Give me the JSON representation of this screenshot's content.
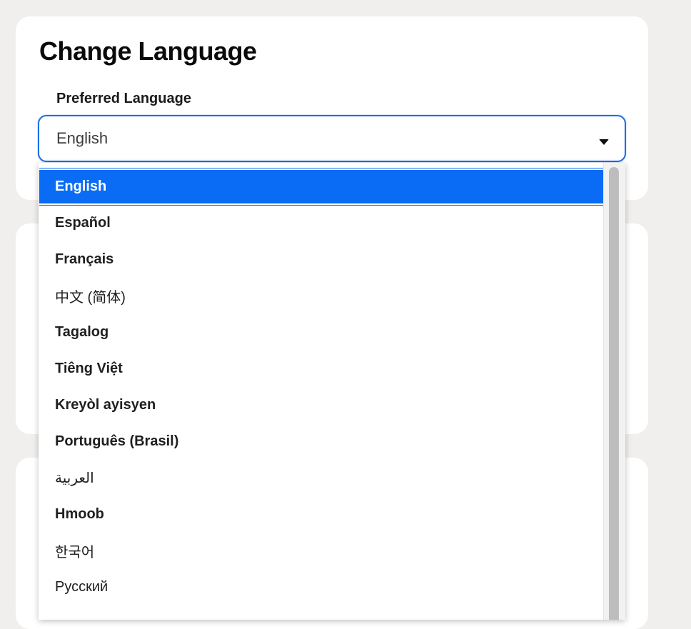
{
  "page": {
    "title": "Change Language"
  },
  "language_field": {
    "label": "Preferred Language",
    "selected_value": "English"
  },
  "dropdown": {
    "options": [
      "English",
      "Español",
      "Français",
      "中文 (简体)",
      "Tagalog",
      "Tiêng Việt",
      "Kreyòl ayisyen",
      "Português (Brasil)",
      "العربية",
      "Hmoob",
      "한국어",
      "Русский"
    ],
    "selected_index": 0
  },
  "colors": {
    "accent": "#0a6cf5",
    "focus_border": "#1b6de8",
    "page_background": "#f0efed"
  }
}
